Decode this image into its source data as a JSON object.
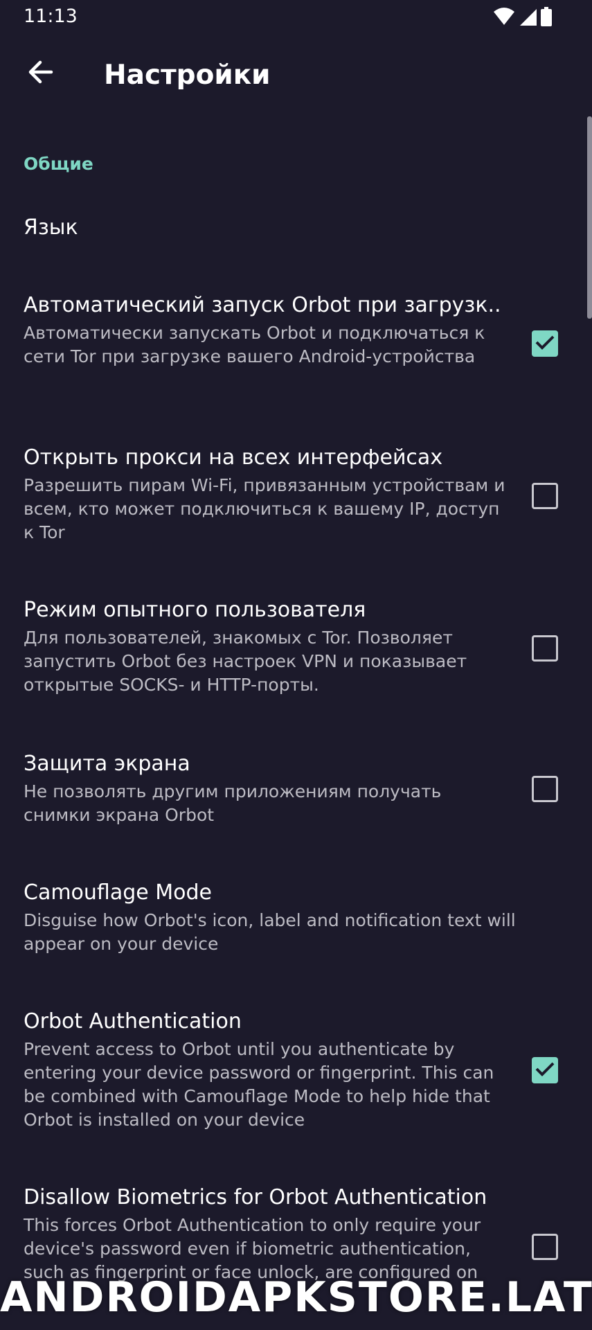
{
  "status_bar": {
    "time": "11:13",
    "icons": [
      "wifi-icon",
      "signal-icon",
      "battery-icon"
    ]
  },
  "app_bar": {
    "title": "Настройки",
    "back_icon": "arrow-left-icon"
  },
  "section": {
    "header": "Общие"
  },
  "prefs": [
    {
      "title": "Язык",
      "summary": ""
    },
    {
      "title": "Автоматический запуск Orbot при загрузк..",
      "summary": "Автоматически запускать Orbot и подключаться к сети Tor при загрузке вашего Android-устройства",
      "checked": true
    },
    {
      "title": "Открыть прокси на всех интерфейсах",
      "summary": "Разрешить пирам Wi-Fi, привязанным устройствам и всем, кто может подключиться к вашему IP, доступ к Tor",
      "checked": false
    },
    {
      "title": "Режим опытного пользователя",
      "summary": "Для пользователей, знакомых с Tor. Позволяет запустить Orbot без настроек VPN и показывает открытые SOCKS- и HTTP-порты.",
      "checked": false
    },
    {
      "title": "Защита экрана",
      "summary": "Не позволять другим приложениям получать снимки экрана Orbot",
      "checked": false
    },
    {
      "title": "Camouflage Mode",
      "summary": "Disguise how Orbot's icon, label and notification text will appear on your device"
    },
    {
      "title": "Orbot Authentication",
      "summary": "Prevent access to Orbot until you authenticate by entering your device password or fingerprint. This can be combined with Camouflage Mode to help hide that Orbot is installed on your device",
      "checked": true
    },
    {
      "title": "Disallow Biometrics for Orbot Authentication",
      "summary": "This forces Orbot Authentication to only require your device's password even if biometric authentication, such as fingerprint or face unlock, are configured on",
      "checked": false
    }
  ],
  "watermark": "ANDROIDAPKSTORE.LAT",
  "colors": {
    "background": "#1c1a2b",
    "accent": "#7fd7c4",
    "summary_text": "#bdbcc4"
  }
}
